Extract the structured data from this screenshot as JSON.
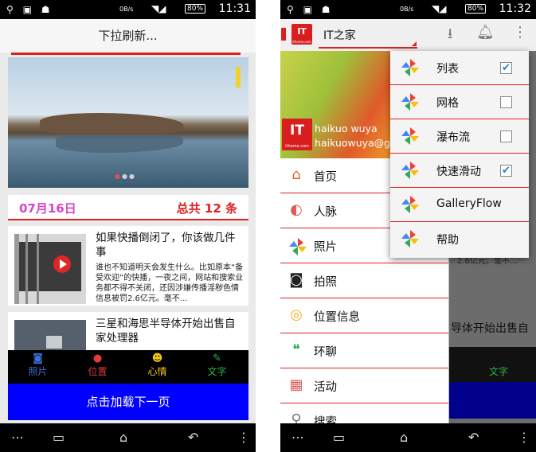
{
  "status_left": {
    "net": "0B/s",
    "battery": "80%",
    "time": "11:31"
  },
  "status_right": {
    "net": "0B/s",
    "battery": "80%",
    "time": "11:32"
  },
  "left": {
    "title": "下拉刷新...",
    "date": "07月16日",
    "total": "总共 12 条",
    "articles": [
      {
        "title": "如果快播倒闭了，你该做几件事",
        "summary": "谁也不知道明天会发生什么。比如原本“备受欢迎”的快播，一夜之间，网站和搜索业务都不得不关闭，还因涉嫌传播淫秽色情信息被罚2.6亿元。毫不..."
      },
      {
        "title": "三星和海思半导体开始出售自家处理器",
        "summary": ""
      }
    ],
    "tabs": [
      {
        "icon": "camera-icon",
        "label": "照片",
        "color": "#3a6fd8"
      },
      {
        "icon": "location-pin-icon",
        "label": "位置",
        "color": "#e03c3c"
      },
      {
        "icon": "smiley-icon",
        "label": "心情",
        "color": "#f2c80f"
      },
      {
        "icon": "pencil-icon",
        "label": "文字",
        "color": "#2fb24a"
      }
    ],
    "load_more": "点击加载下一页"
  },
  "right": {
    "app_title": "IT之家",
    "logo_text": "IT",
    "logo_sub": "ithome.com",
    "user_name": "haikuo wuya",
    "user_email": "haikuowuya@g",
    "drawer_items": [
      {
        "icon": "home-icon",
        "label": "首页"
      },
      {
        "icon": "people-icon",
        "label": "人脉"
      },
      {
        "icon": "photos-pinwheel-icon",
        "label": "照片"
      },
      {
        "icon": "camera-icon",
        "label": "拍照"
      },
      {
        "icon": "location-icon",
        "label": "位置信息"
      },
      {
        "icon": "hangouts-icon",
        "label": "环聊"
      },
      {
        "icon": "calendar-icon",
        "label": "活动"
      },
      {
        "icon": "search-icon",
        "label": "搜索"
      }
    ],
    "popup_items": [
      {
        "label": "列表",
        "checked": true,
        "has_checkbox": true
      },
      {
        "label": "网格",
        "checked": false,
        "has_checkbox": true
      },
      {
        "label": "瀑布流",
        "checked": false,
        "has_checkbox": true
      },
      {
        "label": "快速滑动",
        "checked": true,
        "has_checkbox": true
      },
      {
        "label": "GalleryFlow",
        "checked": false,
        "has_checkbox": false
      },
      {
        "label": "帮助",
        "checked": false,
        "has_checkbox": false
      }
    ],
    "background_visible": {
      "tab_label": "文字",
      "summary_frag": "2.6亿元。毫不...",
      "title_frag": "导体开始出售自"
    }
  },
  "colors": {
    "accent_red": "#e02020",
    "load_blue": "#0000ff",
    "date_pink": "#d445c9"
  }
}
